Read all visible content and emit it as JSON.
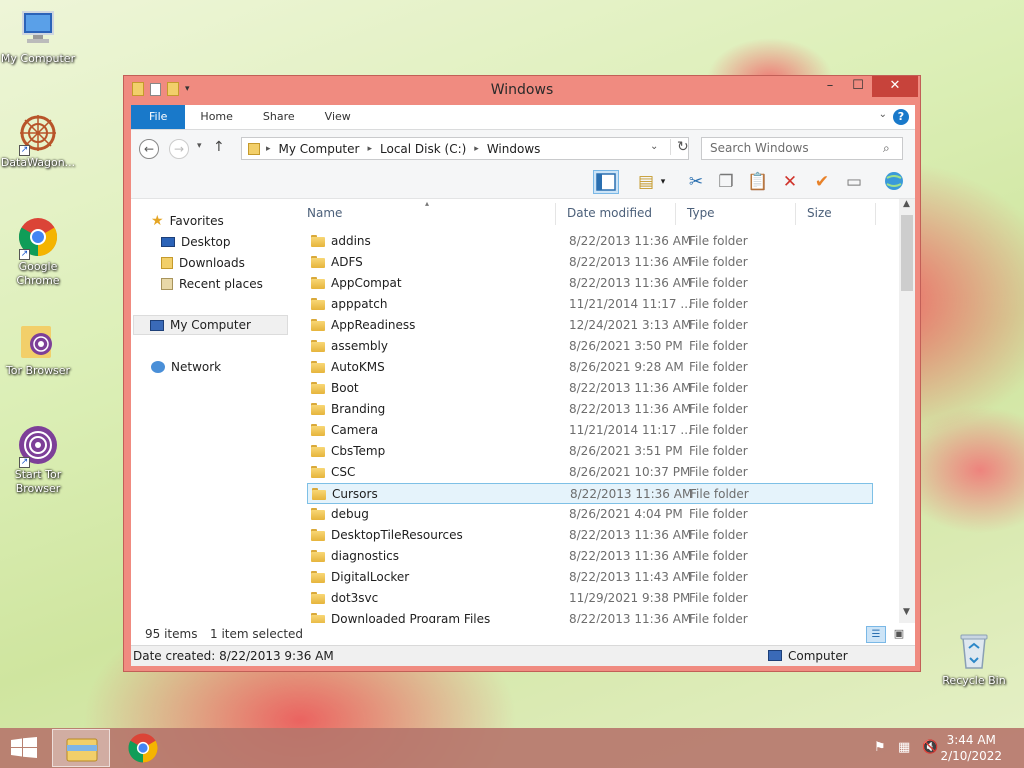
{
  "desktop": {
    "icons": [
      {
        "label": "My Computer"
      },
      {
        "label": "DataWagon..."
      },
      {
        "label": "Google Chrome"
      },
      {
        "label": "Tor Browser"
      },
      {
        "label": "Start Tor Browser"
      },
      {
        "label": "Recycle Bin"
      }
    ]
  },
  "window": {
    "title": "Windows",
    "ribbon_tabs": [
      "File",
      "Home",
      "Share",
      "View"
    ],
    "help_label": "?",
    "address": {
      "crumbs": [
        "My Computer",
        "Local Disk (C:)",
        "Windows"
      ]
    },
    "search": {
      "placeholder": "Search Windows"
    },
    "nav": {
      "favorites": "Favorites",
      "desktop": "Desktop",
      "downloads": "Downloads",
      "recent": "Recent places",
      "computer": "My Computer",
      "network": "Network"
    },
    "columns": {
      "name": "Name",
      "date": "Date modified",
      "type": "Type",
      "size": "Size"
    },
    "files": [
      {
        "name": "addins",
        "date": "8/22/2013 11:36 AM",
        "type": "File folder"
      },
      {
        "name": "ADFS",
        "date": "8/22/2013 11:36 AM",
        "type": "File folder"
      },
      {
        "name": "AppCompat",
        "date": "8/22/2013 11:36 AM",
        "type": "File folder"
      },
      {
        "name": "apppatch",
        "date": "11/21/2014 11:17 ...",
        "type": "File folder"
      },
      {
        "name": "AppReadiness",
        "date": "12/24/2021 3:13 AM",
        "type": "File folder"
      },
      {
        "name": "assembly",
        "date": "8/26/2021 3:50 PM",
        "type": "File folder"
      },
      {
        "name": "AutoKMS",
        "date": "8/26/2021 9:28 AM",
        "type": "File folder"
      },
      {
        "name": "Boot",
        "date": "8/22/2013 11:36 AM",
        "type": "File folder"
      },
      {
        "name": "Branding",
        "date": "8/22/2013 11:36 AM",
        "type": "File folder"
      },
      {
        "name": "Camera",
        "date": "11/21/2014 11:17 ...",
        "type": "File folder"
      },
      {
        "name": "CbsTemp",
        "date": "8/26/2021 3:51 PM",
        "type": "File folder"
      },
      {
        "name": "CSC",
        "date": "8/26/2021 10:37 PM",
        "type": "File folder"
      },
      {
        "name": "Cursors",
        "date": "8/22/2013 11:36 AM",
        "type": "File folder"
      },
      {
        "name": "debug",
        "date": "8/26/2021 4:04 PM",
        "type": "File folder"
      },
      {
        "name": "DesktopTileResources",
        "date": "8/22/2013 11:36 AM",
        "type": "File folder"
      },
      {
        "name": "diagnostics",
        "date": "8/22/2013 11:36 AM",
        "type": "File folder"
      },
      {
        "name": "DigitalLocker",
        "date": "8/22/2013 11:43 AM",
        "type": "File folder"
      },
      {
        "name": "dot3svc",
        "date": "11/29/2021 9:38 PM",
        "type": "File folder"
      },
      {
        "name": "Downloaded Program Files",
        "date": "8/22/2013 11:36 AM",
        "type": "File folder"
      }
    ],
    "selected_index": 12,
    "status": {
      "count": "95 items",
      "selected": "1 item selected"
    },
    "details": {
      "created": "Date created: 8/22/2013 9:36 AM",
      "location": "Computer"
    }
  },
  "taskbar": {
    "time": "3:44 AM",
    "date": "2/10/2022"
  }
}
